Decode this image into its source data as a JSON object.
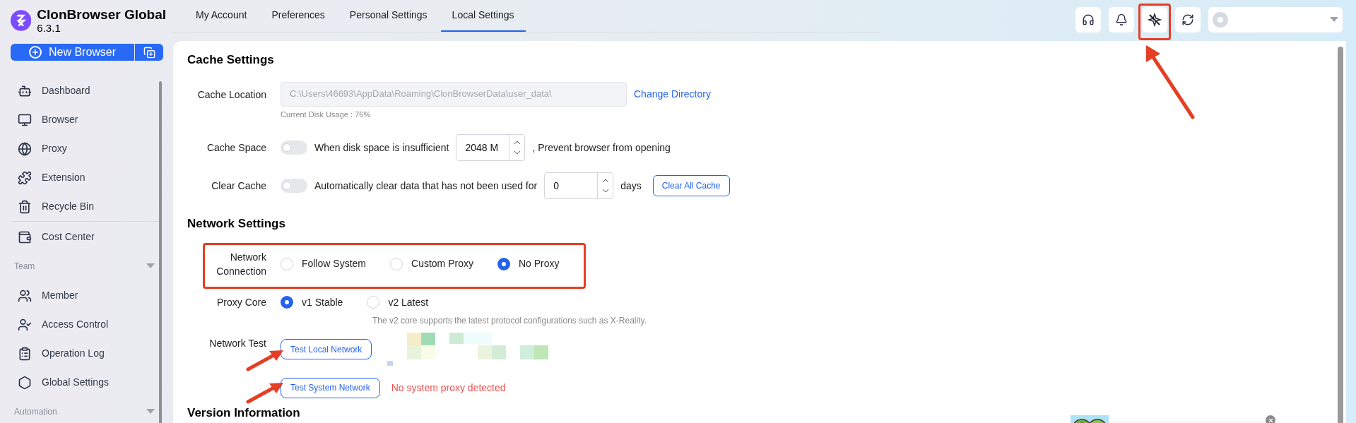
{
  "app": {
    "name": "ClonBrowser Global",
    "version": "6.3.1"
  },
  "new_browser": {
    "label": "New Browser"
  },
  "sidebar": {
    "groups": [
      {
        "items": [
          {
            "label": "Dashboard"
          },
          {
            "label": "Browser"
          },
          {
            "label": "Proxy"
          },
          {
            "label": "Extension"
          },
          {
            "label": "Recycle Bin"
          }
        ]
      },
      {
        "items": [
          {
            "label": "Cost Center"
          }
        ]
      },
      {
        "heading": "Team",
        "items": [
          {
            "label": "Member"
          },
          {
            "label": "Access Control"
          },
          {
            "label": "Operation Log"
          },
          {
            "label": "Global Settings"
          }
        ]
      },
      {
        "heading": "Automation"
      }
    ]
  },
  "tabs": [
    {
      "label": "My Account",
      "selected": false
    },
    {
      "label": "Preferences",
      "selected": false
    },
    {
      "label": "Personal Settings",
      "selected": false
    },
    {
      "label": "Local Settings",
      "selected": true
    }
  ],
  "cache": {
    "title": "Cache Settings",
    "location": {
      "label": "Cache Location",
      "value": "C:\\Users\\46693\\AppData\\Roaming\\ClonBrowserData\\user_data\\",
      "link": "Change Directory",
      "usage": "Current Disk Usage : 76%"
    },
    "space": {
      "label": "Cache Space",
      "on": false,
      "text": "When disk space is insufficient",
      "value": "2048 M",
      "suffix": ", Prevent browser from opening"
    },
    "clear": {
      "label": "Clear Cache",
      "on": false,
      "text": "Automatically clear data that has not been used for",
      "value": "0",
      "suffix": "days",
      "button": "Clear All Cache"
    }
  },
  "network": {
    "title": "Network Settings",
    "connection": {
      "label": "Network Connection",
      "options": [
        {
          "label": "Follow System",
          "selected": false
        },
        {
          "label": "Custom Proxy",
          "selected": false
        },
        {
          "label": "No Proxy",
          "selected": true
        }
      ]
    },
    "core": {
      "label": "Proxy Core",
      "options": [
        {
          "label": "v1 Stable",
          "selected": true
        },
        {
          "label": "v2 Latest",
          "selected": false
        }
      ],
      "hint": "The v2 core supports the latest protocol configurations such as X-Reality."
    },
    "test": {
      "label": "Network Test",
      "buttons": [
        "Test Local Network",
        "Test System Network"
      ],
      "result": "No system proxy detected"
    }
  },
  "version": {
    "title": "Version Information"
  }
}
